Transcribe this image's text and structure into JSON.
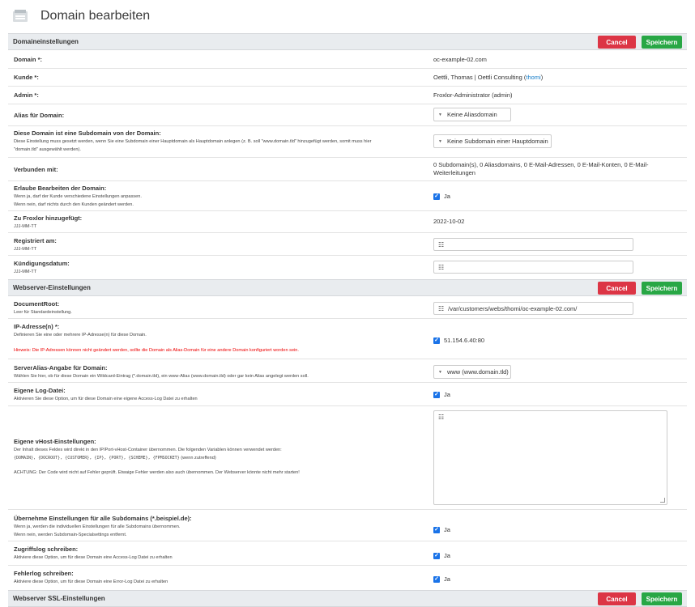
{
  "page": {
    "title": "Domain bearbeiten"
  },
  "buttons": {
    "cancel": "Cancel",
    "save": "Speichern"
  },
  "sections": {
    "domain": "Domaineinstellungen",
    "webserver": "Webserver-Einstellungen",
    "ssl": "Webserver SSL-Einstellungen"
  },
  "domain_settings": {
    "domain": {
      "label": "Domain *:",
      "value": "oc-example-02.com"
    },
    "customer": {
      "label": "Kunde *:",
      "value": "Oettli, Thomas | Oettli Consulting (",
      "link": "thomi",
      "suffix": ")"
    },
    "admin": {
      "label": "Admin *:",
      "value": "Froxlor-Administrator (admin)"
    },
    "alias": {
      "label": "Alias für Domain:",
      "value": "Keine Aliasdomain"
    },
    "subdomain_of": {
      "label": "Diese Domain ist eine Subdomain von der Domain:",
      "desc1": "Diese Einstellung muss gesetzt werden, wenn Sie eine Subdomain einer Hauptdomain als Hauptdomain anlegen (z. B. soll \"www.domain.tld\" hinzugefügt werden, somit muss hier",
      "desc2": "\"domain.tld\" ausgewählt werden).",
      "value": "Keine Subdomain einer Hauptdomain"
    },
    "connected": {
      "label": "Verbunden mit:",
      "value1": "0 Subdomain(s), 0 Aliasdomains, 0 E-Mail-Adressen, 0 E-Mail-Konten, 0 E-Mail-",
      "value2": "Weiterleitungen"
    },
    "allow_edit": {
      "label": "Erlaube Bearbeiten der Domain:",
      "desc1": "Wenn ja, darf der Kunde verschiedene Einstellungen anpassen.",
      "desc2": "Wenn nein, darf nichts durch den Kunden geändert werden.",
      "value": "Ja"
    },
    "added": {
      "label": "Zu Froxlor hinzugefügt:",
      "desc": "JJJ-MM-TT",
      "value": "2022-10-02"
    },
    "registered": {
      "label": "Registriert am:",
      "desc": "JJJ-MM-TT",
      "value": ""
    },
    "termination": {
      "label": "Kündigungsdatum:",
      "desc": "JJJ-MM-TT",
      "value": ""
    }
  },
  "webserver_settings": {
    "docroot": {
      "label": "DocumentRoot:",
      "desc": "Leer für Standardeinstellung.",
      "value": "/var/customers/webs/thomi/oc-example-02.com/"
    },
    "ip": {
      "label": "IP-Adresse(n) *:",
      "desc": "Definieren Sie eine oder mehrere IP-Adresse(n) für diese Domain.",
      "warning": "Hinweis: Die IP-Adressen können nicht geändert werden, sollte die Domain als Alias-Domain für eine andere Domain konfiguriert worden sein.",
      "value": "51.154.6.40:80"
    },
    "serveralias": {
      "label": "ServerAlias-Angabe für Domain:",
      "desc": "Wählen Sie hier, ob für diese Domain ein Wildcard-Eintrag (*.domain.tld), ein www-Alias (www.domain.tld) oder gar kein Alias angelegt werden soll.",
      "value": "www (www.domain.tld)"
    },
    "own_log": {
      "label": "Eigene Log-Datei:",
      "desc": "Aktivieren Sie diese Option, um für diese Domain eine eigene Access-Log Datei zu erhalten",
      "value": "Ja"
    },
    "vhost": {
      "label": "Eigene vHost-Einstellungen:",
      "desc": "Der Inhalt dieses Feldes wird direkt in den IP/Port-vHost-Container übernommen. Die folgenden Variablen können verwendet werden:",
      "vars": "{DOMAIN}, {DOCROOT}, {CUSTOMER}, {IP}, {PORT}, {SCHEME}, {FPMSOCKET}",
      "vars_suffix": " (wenn zutreffend)",
      "warning": "ACHTUNG: Der Code wird nicht auf Fehler geprüft. Etwaige Fehler werden also auch übernommen. Der Webserver könnte nicht mehr starten!",
      "value": ""
    },
    "apply_subdomains": {
      "label": "Übernehme Einstellungen für alle Subdomains (*.beispiel.de):",
      "desc1": "Wenn ja, werden die individuellen Einstellungen für alle Subdomains übernommen.",
      "desc2": "Wenn nein, werden Subdomain-Specialsettings entfernt.",
      "value": "Ja"
    },
    "access_log": {
      "label": "Zugriffslog schreiben:",
      "desc": "Aktiviere diese Option, um für diese Domain eine Access-Log Datei zu erhalten",
      "value": "Ja"
    },
    "error_log": {
      "label": "Fehlerlog schreiben:",
      "desc": "Aktiviere diese Option, um für diese Domain eine Error-Log Datei zu erhalten",
      "value": "Ja"
    }
  },
  "icons": {
    "calendar": "calendar-icon",
    "caret": "caret-down-icon",
    "check": "check-icon"
  },
  "colors": {
    "cancel": "#dc3545",
    "save": "#28a745",
    "checkbox": "#1a73e8",
    "link": "#1a7fc9",
    "warning": "#e00000"
  }
}
